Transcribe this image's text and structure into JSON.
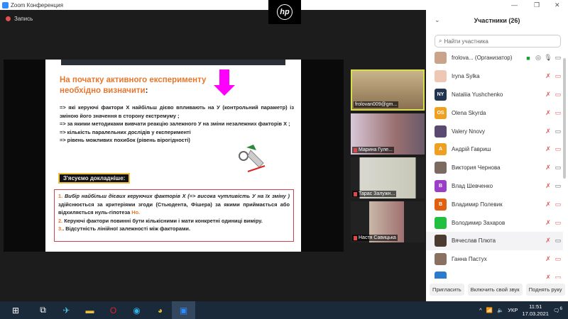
{
  "window": {
    "title": "Zoom Конференция",
    "record_label": "Запись",
    "logo": "hp"
  },
  "slide": {
    "title_line1": "На початку активного експерименту",
    "title_line2": "необхідно визначити",
    "title_colon": ":",
    "bullets": [
      "=> які керуючі фактори Х найбільш  дієво впливають на У (контрольний параметр) із зміною його значення в сторону екстремуму ;",
      "=> за якими методиками вивчати реакцію залежного  У на зміни незалежних факторів Х ;",
      "=> кількість паралельних дослідів у експерименті",
      "=> рівень можливих похибок (рівень вірогідності)"
    ],
    "details_label": "З'ясуємо докладніше:",
    "box": {
      "n1": "1.",
      "p1_italic": "Вибір найбільш дієвих керуючих факторів Х (=> висока чутливість У на їх зміну )",
      "p1_rest": " здійснюється за критеріями згоди (Стьюдента, Фішера) за якими приймається або відхиляється нуль-гіпотеза ",
      "h0": "Но.",
      "n2": "2.",
      "p2": " Керуючі фактори повинні бути кількісними і мати конкретні одиниці виміру.",
      "n3": "3.",
      "p3": ". Відсутність лінійної залежності між факторами."
    }
  },
  "videos": [
    {
      "name": "frolovan009@gm..."
    },
    {
      "name": "Марина Гуле..."
    },
    {
      "name": "Тарас Залужн..."
    },
    {
      "name": "Настя Савицька"
    }
  ],
  "participants": {
    "title": "Участники (26)",
    "search_placeholder": "Найти участника",
    "items": [
      {
        "name": "frolova...  (Организатор)",
        "color": "#c9a48a",
        "initials": ""
      },
      {
        "name": "Iryna Sylka",
        "color": "#efc8b5",
        "initials": ""
      },
      {
        "name": "Nataliia Yushchenko",
        "color": "#1f3550",
        "initials": "NY"
      },
      {
        "name": "Olena Skyrda",
        "color": "#f0a020",
        "initials": "OS"
      },
      {
        "name": "Valery Nnovy",
        "color": "#5a4a70",
        "initials": ""
      },
      {
        "name": "Андрій Гавриш",
        "color": "#f0a020",
        "initials": "А"
      },
      {
        "name": "Виктория Чернова",
        "color": "#7a6a60",
        "initials": ""
      },
      {
        "name": "Влад Шевченко",
        "color": "#9b3fc8",
        "initials": "В"
      },
      {
        "name": "Владимир Полевик",
        "color": "#e06010",
        "initials": "В"
      },
      {
        "name": "Володимир Захаров",
        "color": "#22c040",
        "initials": ""
      },
      {
        "name": "Вячеслав Плюта",
        "color": "#4a3a30",
        "initials": ""
      },
      {
        "name": "Ганна Пастух",
        "color": "#8a7060",
        "initials": ""
      },
      {
        "name": "",
        "color": "#2a7ad0",
        "initials": ""
      }
    ],
    "buttons": {
      "invite": "Пригласить",
      "unmute": "Включить свой звук",
      "raise": "Поднять руку"
    }
  },
  "taskbar": {
    "lang": "УКР",
    "time": "11:51",
    "date": "17.03.2021",
    "notifications": "6"
  }
}
